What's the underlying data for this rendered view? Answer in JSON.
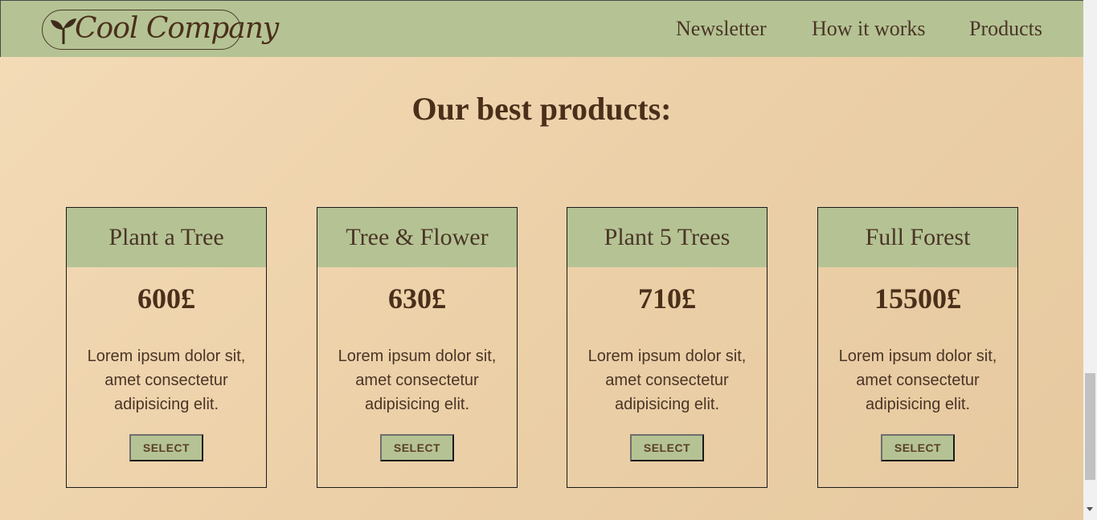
{
  "header": {
    "logo_text": "Cool Company",
    "nav": [
      "Newsletter",
      "How it works",
      "Products"
    ]
  },
  "main": {
    "title": "Our best products:",
    "products": [
      {
        "name": "Plant a Tree",
        "price": "600£",
        "description": "Lorem ipsum dolor sit, amet consectetur adipisicing elit.",
        "button": "SELECT"
      },
      {
        "name": "Tree & Flower",
        "price": "630£",
        "description": "Lorem ipsum dolor sit, amet consectetur adipisicing elit.",
        "button": "SELECT"
      },
      {
        "name": "Plant 5 Trees",
        "price": "710£",
        "description": "Lorem ipsum dolor sit, amet consectetur adipisicing elit.",
        "button": "SELECT"
      },
      {
        "name": "Full Forest",
        "price": "15500£",
        "description": "Lorem ipsum dolor sit, amet consectetur adipisicing elit.",
        "button": "SELECT"
      }
    ]
  },
  "colors": {
    "header_bg": "#b5c394",
    "page_bg": "#ecd0a8",
    "text": "#4a2f1a"
  },
  "icons": {
    "logo": "sprout-icon",
    "scroll_down": "chevron-down-icon"
  }
}
